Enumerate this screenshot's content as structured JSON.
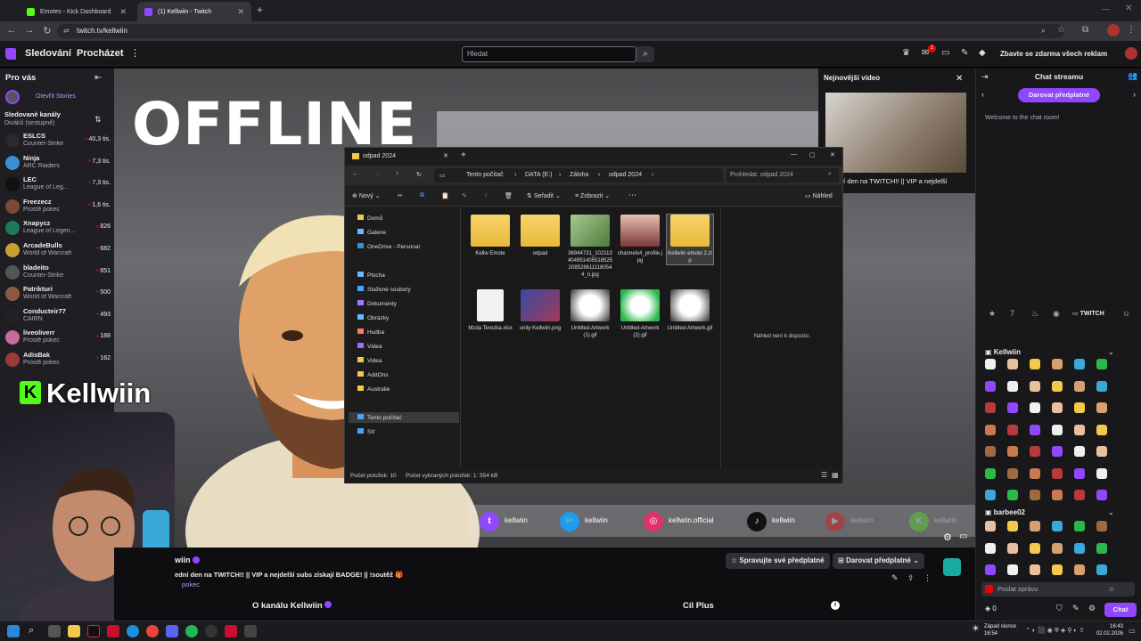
{
  "browser": {
    "tabs": [
      {
        "title": "Emotes - Kick Dashboard"
      },
      {
        "title": "(1) Kellwiin - Twitch"
      }
    ],
    "url": "twitch.tv/kellwiin"
  },
  "topnav": {
    "following": "Sledování",
    "browse": "Procházet",
    "search_placeholder": "Hledat",
    "notif_badge": "1",
    "prime_cta": "Zbavte se zdarma všech reklam"
  },
  "sidebar": {
    "for_you": "Pro vás",
    "stories": "Otevřít Stories",
    "followed_title": "Sledované kanály",
    "followed_sub": "Diváků (sestupně)",
    "items": [
      {
        "name": "ESLCS",
        "game": "Counter-Strike",
        "viewers": "40,3 tis.",
        "color": "#2a2a2a"
      },
      {
        "name": "Ninja",
        "game": "ARC Raiders",
        "viewers": "7,3 tis.",
        "color": "#3a8fd0"
      },
      {
        "name": "LEC",
        "game": "League of Leg...",
        "viewers": "7,3 tis.",
        "color": "#111111"
      },
      {
        "name": "Freezecz",
        "game": "Prostě pokec",
        "viewers": "1,6 tis.",
        "color": "#7a4a35"
      },
      {
        "name": "Xnapycz",
        "game": "League of Legen...",
        "viewers": "826",
        "color": "#1a7a5a"
      },
      {
        "name": "ArcadeBulls",
        "game": "World of Warcraft",
        "viewers": "682",
        "color": "#c8a030"
      },
      {
        "name": "bladeito",
        "game": "Counter-Strike",
        "viewers": "651",
        "color": "#555555"
      },
      {
        "name": "Patrikturi",
        "game": "World of Warcraft",
        "viewers": "500",
        "color": "#8a5a40"
      },
      {
        "name": "Conducteir77",
        "game": "CAIRN",
        "viewers": "493",
        "color": "#222222"
      },
      {
        "name": "liveoliverr",
        "game": "Prostě pokec",
        "viewers": "188",
        "color": "#c86a9a"
      },
      {
        "name": "AdisBak",
        "game": "Prostě pokec",
        "viewers": "162",
        "color": "#9a3a3a"
      }
    ]
  },
  "player": {
    "offline_text": "OFFLINE",
    "kick_name": "Kellwiin",
    "socials": [
      {
        "label": "kellwiin",
        "color": "#9147ff",
        "glyph": "t"
      },
      {
        "label": "kellwiin",
        "color": "#1d9bf0",
        "glyph": "🐦"
      },
      {
        "label": "kellwiin.official",
        "color": "#e1306c",
        "glyph": "◎"
      },
      {
        "label": "kellwiin",
        "color": "#111111",
        "glyph": "♪"
      },
      {
        "label": "kellwiin",
        "color": "#ff0000",
        "glyph": "▶"
      },
      {
        "label": "kellwiin",
        "color": "#53fc18",
        "glyph": "K"
      }
    ]
  },
  "newest_video": {
    "title": "Nejnovější video",
    "caption": "ní den na TWITCH!! || VIP a nejdelší"
  },
  "explorer": {
    "window_title": "odpad 2024",
    "breadcrumb": [
      "Tento počítač",
      "DATA (E:)",
      "Záloha",
      "odpad 2024"
    ],
    "search_placeholder": "Prohledat: odpad 2024",
    "toolbar": {
      "new": "Nový",
      "sort": "Seřadit",
      "view": "Zobrazit",
      "preview": "Náhled"
    },
    "nav": [
      {
        "label": "Domů"
      },
      {
        "label": "Galerie"
      },
      {
        "label": "OneDrive - Personal"
      },
      {
        "label": "Plocha"
      },
      {
        "label": "Stažené soubory"
      },
      {
        "label": "Dokumenty"
      },
      {
        "label": "Obrázky"
      },
      {
        "label": "Hudba"
      },
      {
        "label": "Videa"
      },
      {
        "label": "Videa"
      },
      {
        "label": "AddOns"
      },
      {
        "label": "Australie"
      },
      {
        "label": "Tento počítač"
      },
      {
        "label": "Síť"
      }
    ],
    "files": [
      {
        "name": "Kellw Emote",
        "kind": "folder"
      },
      {
        "name": "odpad",
        "kind": "folder"
      },
      {
        "name": "36944731_1021134049514055185252085286111180544_n.jpg",
        "kind": "photo"
      },
      {
        "name": "channels4_profile.jpg",
        "kind": "portrait"
      },
      {
        "name": "Kellwiin emote 2.zip",
        "kind": "zip"
      },
      {
        "name": "Mzda Terezka.xlsx",
        "kind": "doc"
      },
      {
        "name": "unity Kellwiin.png",
        "kind": "image"
      },
      {
        "name": "Untitled-Artwork (1).gif",
        "kind": "gif"
      },
      {
        "name": "Untitled-Artwork (2).gif",
        "kind": "gifgreen"
      },
      {
        "name": "Untitled-Artwork.gif",
        "kind": "gif"
      }
    ],
    "preview_text": "Náhled není k dispozici.",
    "status_items": "Počet položek: 10",
    "status_selected": "Počet vybraných položek: 1: 554 kB"
  },
  "info": {
    "channel": "wiin",
    "stream_title": "ední den na TWITCH!! || VIP a nejdelší subs získají BADGE! || !soutěž",
    "category": "pokec",
    "manage_sub": "Spravujte své předplatné",
    "gift_sub": "Darovat předplatné",
    "about": "O kanálu Kellwiin",
    "goal": "Cíl Plus"
  },
  "chat": {
    "title": "Chat streamu",
    "gift_btn": "Darovat předplatné",
    "welcome": "Welcome to the chat room!",
    "emote_tab_active": "TWITCH",
    "emote_set_1": "Kellwiin",
    "emote_set_2": "barbee02",
    "input_placeholder": "Poslat zprávu",
    "points": "0",
    "chat_btn": "Chat"
  },
  "taskbar": {
    "weather": "Západ slunce",
    "weather_time": "16:54",
    "clock": "16:43",
    "date": "02.02.2026"
  }
}
